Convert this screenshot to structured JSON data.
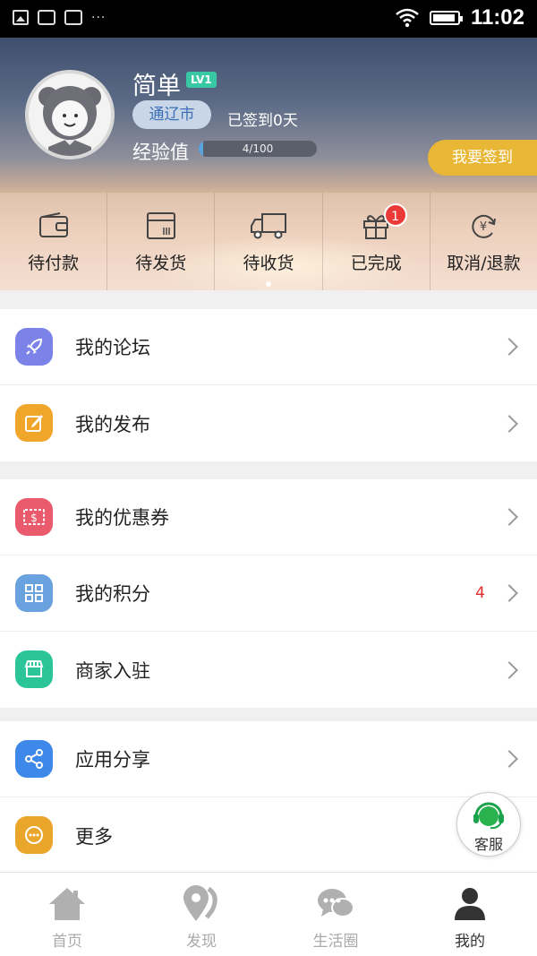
{
  "status_bar": {
    "time": "11:02",
    "dots": "···"
  },
  "profile": {
    "name": "简单",
    "level": "LV1",
    "city": "通辽市",
    "signed_text": "已签到0天",
    "exp_label": "经验值",
    "exp_text": "4/100",
    "exp_progress": 0.04,
    "checkin_label": "我要签到"
  },
  "orders": [
    {
      "label": "待付款",
      "icon": "wallet-icon"
    },
    {
      "label": "待发货",
      "icon": "package-icon"
    },
    {
      "label": "待收货",
      "icon": "truck-icon"
    },
    {
      "label": "已完成",
      "icon": "gift-icon",
      "badge": "1"
    },
    {
      "label": "取消/退款",
      "icon": "refund-icon"
    }
  ],
  "menu_groups": [
    [
      {
        "label": "我的论坛",
        "icon": "rocket-icon",
        "color": "#7b83e8"
      },
      {
        "label": "我的发布",
        "icon": "edit-icon",
        "color": "#f0a62b"
      }
    ],
    [
      {
        "label": "我的优惠券",
        "icon": "coupon-icon",
        "color": "#e85a6c"
      },
      {
        "label": "我的积分",
        "icon": "grid-icon",
        "color": "#6aa2e0",
        "count": "4"
      },
      {
        "label": "商家入驻",
        "icon": "store-icon",
        "color": "#2cc59a"
      }
    ],
    [
      {
        "label": "应用分享",
        "icon": "share-icon",
        "color": "#3d88e8"
      },
      {
        "label": "更多",
        "icon": "more-icon",
        "color": "#e9a62a"
      }
    ]
  ],
  "service_label": "客服",
  "tabs": [
    {
      "label": "首页",
      "icon": "home-icon"
    },
    {
      "label": "发现",
      "icon": "location-icon"
    },
    {
      "label": "生活圈",
      "icon": "chat-icon"
    },
    {
      "label": "我的",
      "icon": "user-icon",
      "active": true
    }
  ]
}
